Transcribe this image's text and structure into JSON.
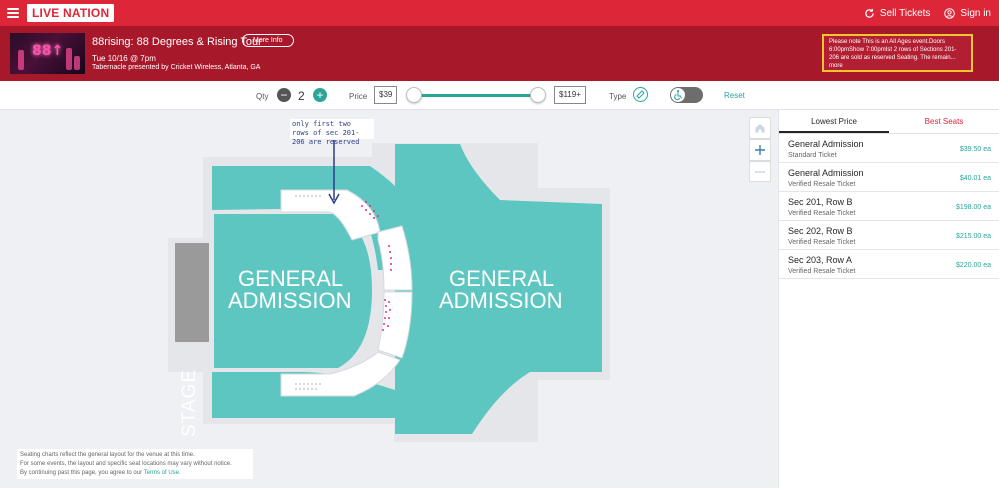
{
  "nav": {
    "brand": "LIVE NATION",
    "sell_tickets": "Sell Tickets",
    "sign_in": "Sign in"
  },
  "event": {
    "title": "88rising: 88 Degrees & Rising Tour",
    "more_info": "More Info",
    "date": "Tue 10/16 @ 7pm",
    "venue": "Tabernacle presented by Cricket Wireless, Atlanta, GA",
    "thumb_text": "88↑",
    "notice": "Please note  This is an All Ages event.Doors 6:00pmShow 7:00pmIst 2 rows of Sections 201-206 are sold as reserved Seating. The remain... more"
  },
  "filters": {
    "qty_label": "Qty",
    "qty_value": "2",
    "price_label": "Price",
    "price_min": "$39",
    "price_max": "$119+",
    "type_label": "Type",
    "reset": "Reset"
  },
  "map": {
    "callout": "only first two rows of sec 201-206 are reserved",
    "stage": "STAGE",
    "ga_left_1": "GENERAL",
    "ga_left_2": "ADMISSION",
    "ga_right_1": "GENERAL",
    "ga_right_2": "ADMISSION",
    "disclaimer_1": "Seating charts reflect the general layout for the venue at this time.",
    "disclaimer_2": "For some events, the layout and specific seat locations may vary without notice.",
    "disclaimer_3": "By continuing past this page, you agree to our",
    "terms": "Terms of Use."
  },
  "panel": {
    "tabs": [
      "Lowest Price",
      "Best Seats"
    ],
    "listings": [
      {
        "name": "General Admission",
        "type": "Standard Ticket",
        "price": "$39.50 ea"
      },
      {
        "name": "General Admission",
        "type": "Verified Resale Ticket",
        "price": "$40.01 ea"
      },
      {
        "name": "Sec 201, Row B",
        "type": "Verified Resale Ticket",
        "price": "$198.00 ea"
      },
      {
        "name": "Sec 202, Row B",
        "type": "Verified Resale Ticket",
        "price": "$215.00 ea"
      },
      {
        "name": "Sec 203, Row A",
        "type": "Verified Resale Ticket",
        "price": "$220.00 ea"
      }
    ]
  },
  "colors": {
    "brand_red": "#dd2638",
    "header_red": "#a7182b",
    "teal": "#2aa597",
    "ga_fill": "#5ec6c0"
  }
}
